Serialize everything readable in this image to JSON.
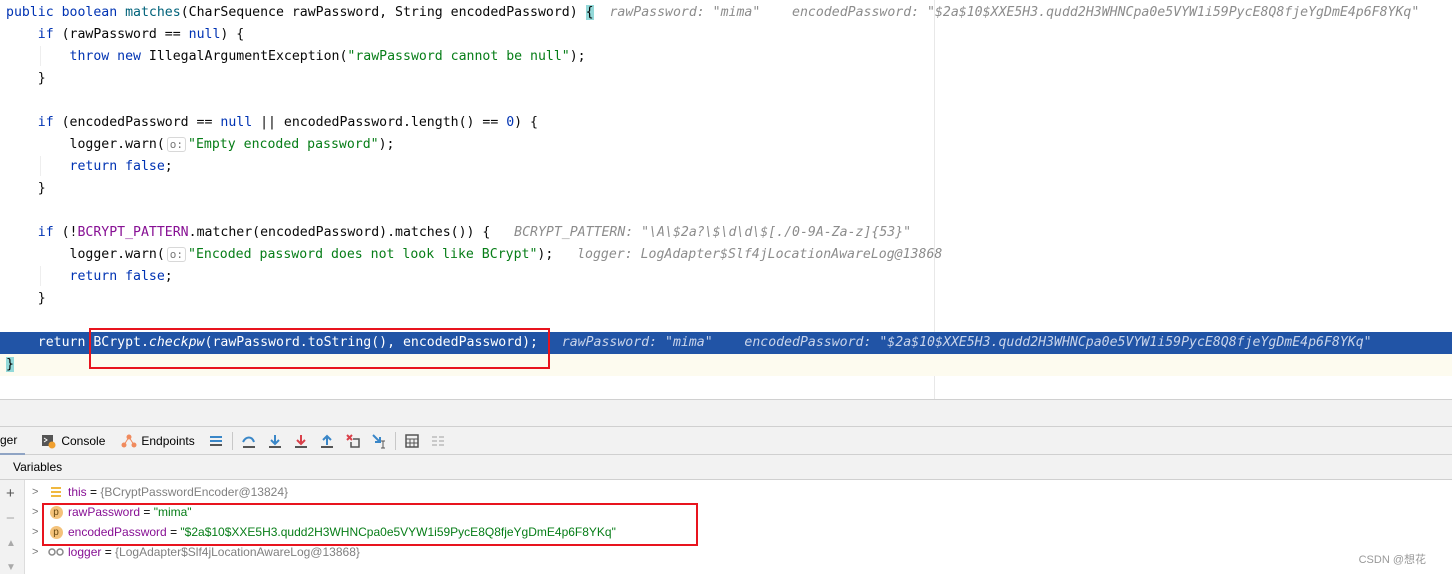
{
  "editor": {
    "lines": [
      [
        [
          "public ",
          "kw"
        ],
        [
          "boolean ",
          "kw"
        ],
        [
          "matches",
          "fn"
        ],
        [
          "(CharSequence rawPassword, String encodedPassword) ",
          "plain"
        ],
        [
          "{",
          "brace"
        ],
        [
          "  rawPassword: \"mima\"    encodedPassword: \"$2a$10$XXE5H3.qudd2H3WHNCpa0e5VYW1i59PycE8Q8fjeYgDmE4p6F8YKq\"",
          "hint"
        ]
      ],
      [
        [
          "    if ",
          "kw"
        ],
        [
          "(rawPassword == ",
          "plain"
        ],
        [
          "null",
          "kw"
        ],
        [
          ") {",
          "plain"
        ]
      ],
      [
        [
          "        throw ",
          "kw"
        ],
        [
          "new ",
          "kw"
        ],
        [
          "IllegalArgumentException(",
          "plain"
        ],
        [
          "\"rawPassword cannot be null\"",
          "str"
        ],
        [
          ");",
          "plain"
        ]
      ],
      [
        [
          "    }",
          "plain"
        ]
      ],
      [],
      [
        [
          "    if ",
          "kw"
        ],
        [
          "(encodedPassword == ",
          "plain"
        ],
        [
          "null ",
          "kw"
        ],
        [
          "|| encodedPassword.length() == ",
          "plain"
        ],
        [
          "0",
          "kw"
        ],
        [
          ") {",
          "plain"
        ]
      ],
      [
        [
          "        logger.warn(",
          "plain"
        ],
        [
          "o:",
          "badge"
        ],
        [
          "\"Empty encoded password\"",
          "str"
        ],
        [
          ");",
          "plain"
        ]
      ],
      [
        [
          "        return ",
          "kw"
        ],
        [
          "false",
          "kw"
        ],
        [
          ";",
          "plain"
        ]
      ],
      [
        [
          "    }",
          "plain"
        ]
      ],
      [],
      [
        [
          "    if ",
          "kw"
        ],
        [
          "(!",
          "plain"
        ],
        [
          "BCRYPT_PATTERN",
          "const"
        ],
        [
          ".matcher(encodedPassword).matches()) {",
          "plain"
        ],
        [
          "   BCRYPT_PATTERN: \"\\A\\$2a?\\$\\d\\d\\$[./0-9A-Za-z]{53}\"",
          "hint"
        ]
      ],
      [
        [
          "        logger.warn(",
          "plain"
        ],
        [
          "o:",
          "badge"
        ],
        [
          "\"Encoded password does not look like BCrypt\"",
          "str"
        ],
        [
          ");",
          "plain"
        ],
        [
          "   logger: LogAdapter$Slf4jLocationAwareLog@13868",
          "hint"
        ]
      ],
      [
        [
          "        return ",
          "kw"
        ],
        [
          "false",
          "kw"
        ],
        [
          ";",
          "plain"
        ]
      ],
      [
        [
          "    }",
          "plain"
        ]
      ],
      [],
      [
        [
          "    return ",
          "kw"
        ],
        [
          "BCrypt.",
          "plain"
        ],
        [
          "checkpw",
          "it"
        ],
        [
          "(rawPassword.toString(), encodedPassword);",
          "plain"
        ],
        [
          "   rawPassword: \"mima\"    encodedPassword: \"$2a$10$XXE5H3.qudd2H3WHNCpa0e5VYW1i59PycE8Q8fjeYgDmE4p6F8YKq\"",
          "hint"
        ]
      ],
      [
        [
          "}",
          "brace"
        ]
      ]
    ],
    "current_line": 15
  },
  "toolbar": {
    "tabs": [
      {
        "label": "ger",
        "icon": "debugger-icon"
      },
      {
        "label": "Console",
        "icon": "console-icon"
      },
      {
        "label": "Endpoints",
        "icon": "endpoints-icon"
      }
    ],
    "actions": [
      "layout-menu-icon",
      "show-execution-point-icon",
      "step-over-icon",
      "step-into-icon",
      "force-step-into-icon",
      "step-out-icon",
      "drop-frame-icon",
      "run-to-cursor-icon",
      "evaluate-expression-icon",
      "trace-icon"
    ]
  },
  "variables": {
    "title": "Variables",
    "rows": [
      {
        "icon": "field-icon",
        "name": "this",
        "eq": " = ",
        "value": "{BCryptPasswordEncoder@13824}",
        "kind": "obj"
      },
      {
        "icon": "parameter-icon",
        "name": "rawPassword",
        "eq": " = ",
        "value": "\"mima\"",
        "kind": "str"
      },
      {
        "icon": "parameter-icon",
        "name": "encodedPassword",
        "eq": " = ",
        "value": "\"$2a$10$XXE5H3.qudd2H3WHNCpa0e5VYW1i59PycE8Q8fjeYgDmE4p6F8YKq\"",
        "kind": "str"
      },
      {
        "icon": "watch-icon",
        "name": "logger",
        "eq": " = ",
        "value": "{LogAdapter$Slf4jLocationAwareLog@13868}",
        "kind": "obj"
      }
    ],
    "param_badge": "p"
  },
  "watermark": "CSDN @想花"
}
